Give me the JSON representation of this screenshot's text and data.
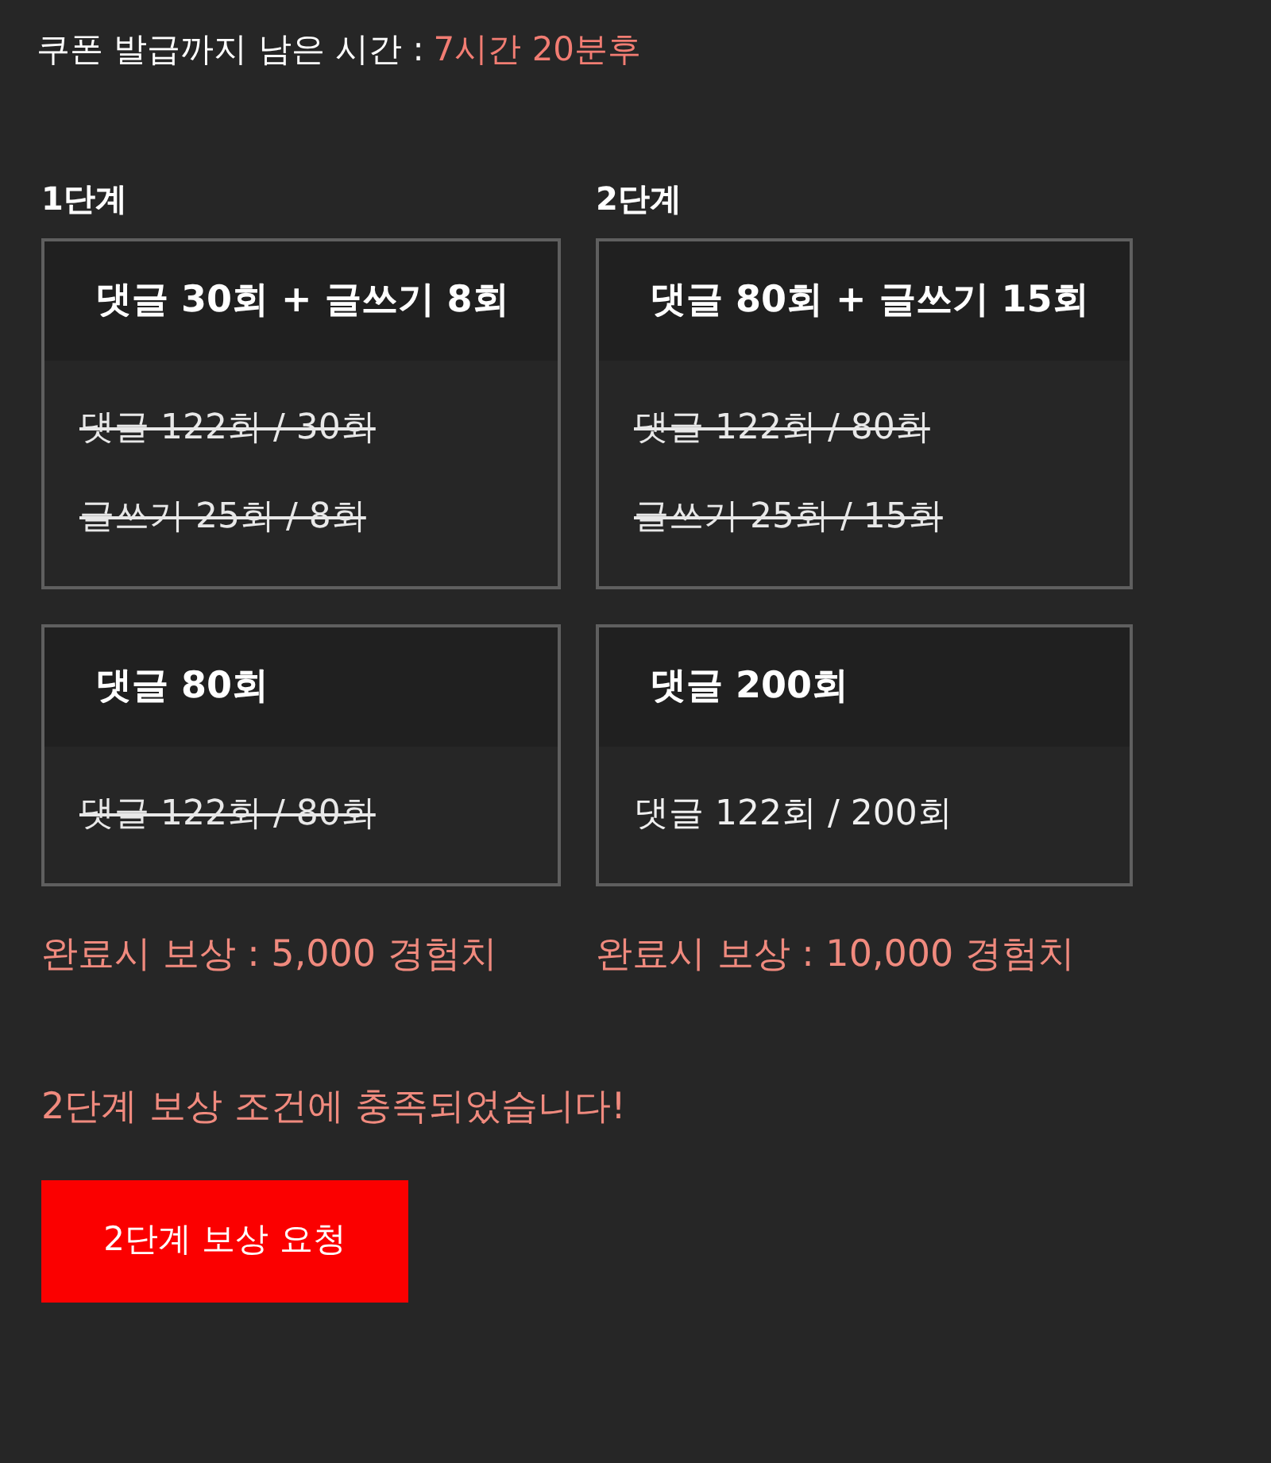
{
  "header": {
    "label": "쿠폰 발급까지 남은 시간 :",
    "time": "7시간 20분후"
  },
  "stages": [
    {
      "title": "1단계",
      "missions": [
        {
          "title": "댓글 30회 + 글쓰기 8회",
          "progress": [
            {
              "text": "댓글 122회 / 30회",
              "completed": true
            },
            {
              "text": "글쓰기 25회 / 8회",
              "completed": true
            }
          ]
        },
        {
          "title": "댓글 80회",
          "progress": [
            {
              "text": "댓글 122회 / 80회",
              "completed": true
            }
          ]
        }
      ],
      "reward": "완료시 보상 : 5,000 경험치"
    },
    {
      "title": "2단계",
      "missions": [
        {
          "title": "댓글 80회 + 글쓰기 15회",
          "progress": [
            {
              "text": "댓글 122회 / 80회",
              "completed": true
            },
            {
              "text": "글쓰기 25회 / 15회",
              "completed": true
            }
          ]
        },
        {
          "title": "댓글 200회",
          "progress": [
            {
              "text": "댓글 122회 / 200회",
              "completed": false
            }
          ]
        }
      ],
      "reward": "완료시 보상 : 10,000 경험치"
    }
  ],
  "message": "2단계 보상 조건에 충족되었습니다!",
  "button": "2단계 보상 요청"
}
